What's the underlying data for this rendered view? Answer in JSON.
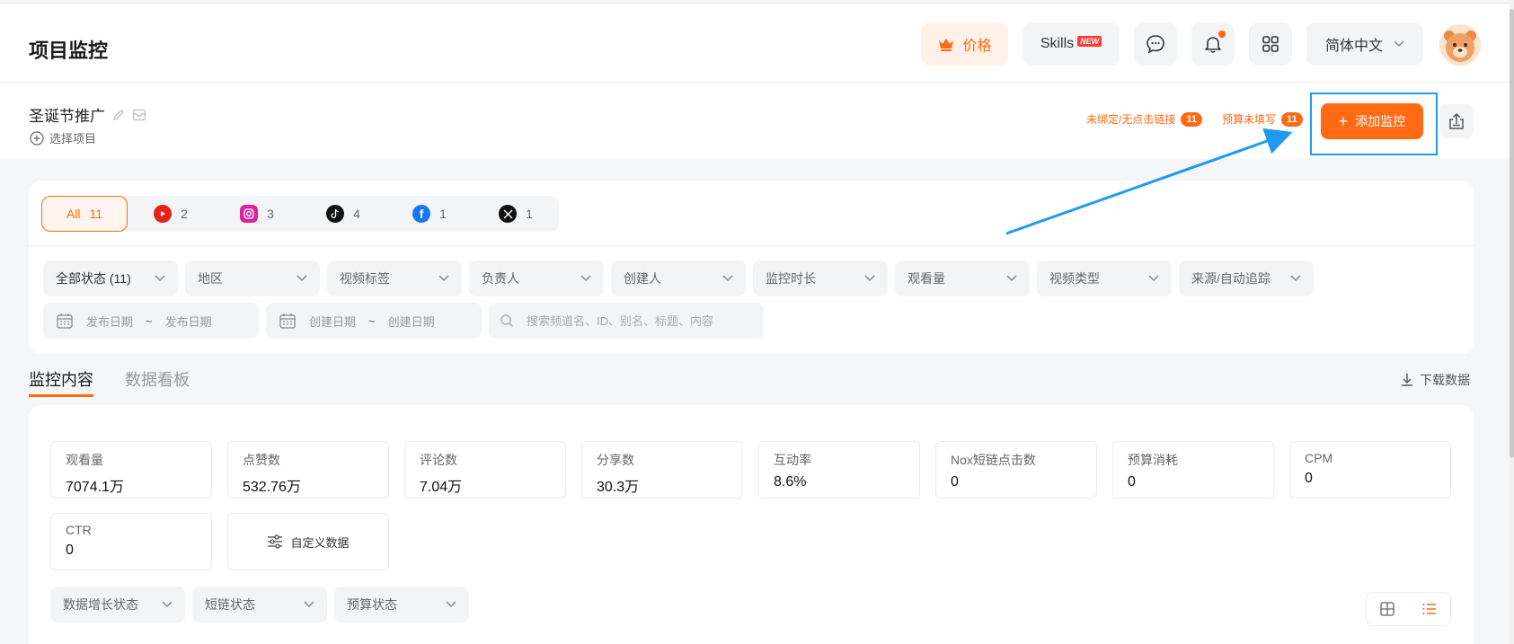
{
  "header": {
    "title": "项目监控",
    "price_label": "价格",
    "skills_label": "Skills",
    "skills_badge": "NEW",
    "language": "简体中文"
  },
  "project": {
    "name": "圣诞节推广",
    "select_label": "选择项目",
    "warning_unbound_label": "未绑定/无点击链接",
    "warning_unbound_count": "11",
    "warning_budget_label": "预算未填写",
    "warning_budget_count": "11",
    "add_button": "添加监控"
  },
  "platforms": [
    {
      "label": "All",
      "count": "11",
      "icon": "all",
      "active": true
    },
    {
      "label": "",
      "count": "2",
      "icon": "youtube-icon",
      "color": "#e62117"
    },
    {
      "label": "",
      "count": "3",
      "icon": "instagram-icon",
      "color": "#d6249f"
    },
    {
      "label": "",
      "count": "4",
      "icon": "tiktok-icon",
      "color": "#111111"
    },
    {
      "label": "",
      "count": "1",
      "icon": "facebook-icon",
      "color": "#1877f2"
    },
    {
      "label": "",
      "count": "1",
      "icon": "x-icon",
      "color": "#111111"
    }
  ],
  "filters": [
    "全部状态 (11)",
    "地区",
    "视频标签",
    "负责人",
    "创建人",
    "监控时长",
    "观看量",
    "视频类型",
    "来源/自动追踪"
  ],
  "date_publish": {
    "start": "发布日期",
    "sep": "~",
    "end": "发布日期"
  },
  "date_create": {
    "start": "创建日期",
    "sep": "~",
    "end": "创建日期"
  },
  "search": {
    "placeholder": "搜索频道名、ID、别名、标题、内容"
  },
  "tabs": {
    "monitor": "监控内容",
    "board": "数据看板",
    "download": "下载数据"
  },
  "stats": [
    {
      "label": "观看量",
      "value": "7074.1万"
    },
    {
      "label": "点赞数",
      "value": "532.76万"
    },
    {
      "label": "评论数",
      "value": "7.04万"
    },
    {
      "label": "分享数",
      "value": "30.3万"
    },
    {
      "label": "互动率",
      "value": "8.6%"
    },
    {
      "label": "Nox短链点击数",
      "value": "0"
    },
    {
      "label": "预算消耗",
      "value": "0"
    },
    {
      "label": "CPM",
      "value": "0"
    },
    {
      "label": "CTR",
      "value": "0"
    }
  ],
  "custom_data_label": "自定义数据",
  "sub_filters": [
    "数据增长状态",
    "短链状态",
    "预算状态"
  ],
  "colors": {
    "accent": "#ff6a13",
    "highlight": "#1e9bf0"
  }
}
